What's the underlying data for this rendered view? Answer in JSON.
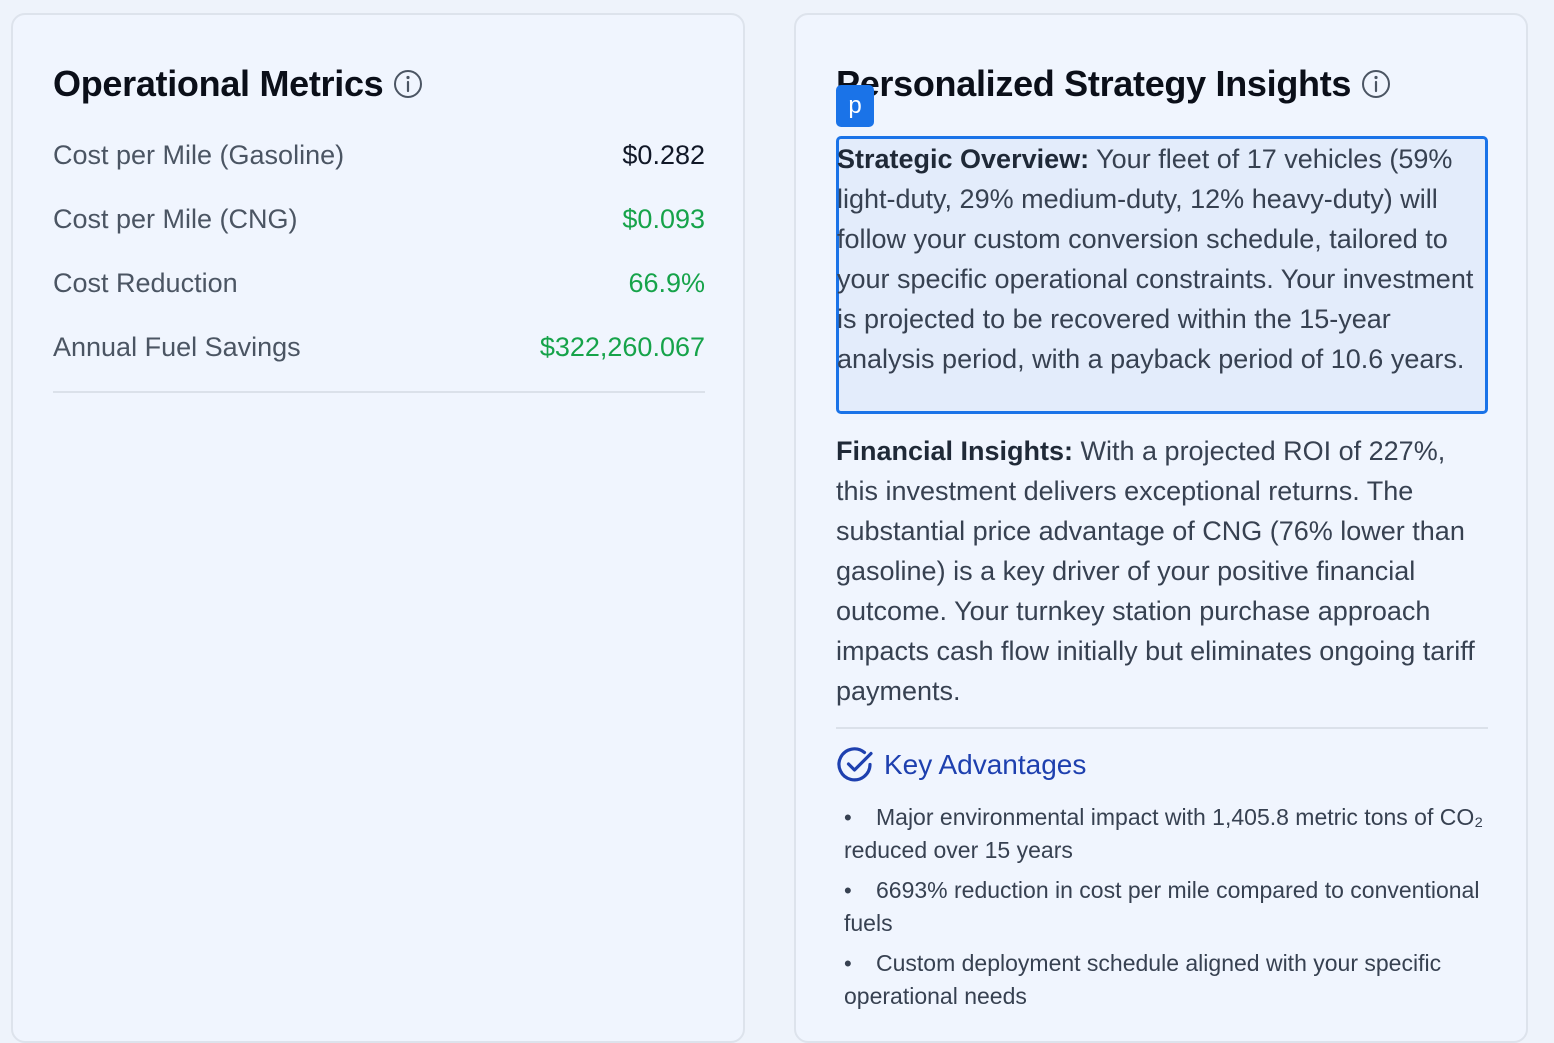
{
  "operational_metrics": {
    "title": "Operational Metrics",
    "rows": [
      {
        "label": "Cost per Mile (Gasoline)",
        "value": "$0.282"
      },
      {
        "label": "Cost per Mile (CNG)",
        "value": "$0.093"
      },
      {
        "label": "Cost Reduction",
        "value": "66.9%"
      },
      {
        "label": "Annual Fuel Savings",
        "value": "$322,260.067"
      }
    ]
  },
  "strategy_insights": {
    "title": "Personalized Strategy Insights",
    "tag": "p",
    "overview_label": "Strategic Overview:",
    "overview_text": " Your fleet of 17 vehicles (59% light-duty, 29% medium-duty, 12% heavy-duty) will follow your custom conversion schedule, tailored to your specific operational constraints. Your investment is projected to be recovered within the 15-year analysis period, with a payback period of 10.6 years.",
    "financial_label": "Financial Insights:",
    "financial_text": " With a projected ROI of 227%, this investment delivers exceptional returns. The substantial price advantage of CNG (76% lower than gasoline) is a key driver of your positive financial outcome. Your turnkey station purchase approach impacts cash flow initially but eliminates ongoing tariff payments.",
    "advantages_heading": "Key Advantages",
    "advantages": [
      "Major environmental impact with 1,405.8 metric tons of CO₂ reduced over 15 years",
      "6693% reduction in cost per mile compared to conventional fuels",
      "Custom deployment schedule aligned with your specific operational needs"
    ]
  },
  "colors": {
    "accent": "#1a73e8",
    "positive": "#16a34a",
    "heading_blue": "#1e40af"
  }
}
